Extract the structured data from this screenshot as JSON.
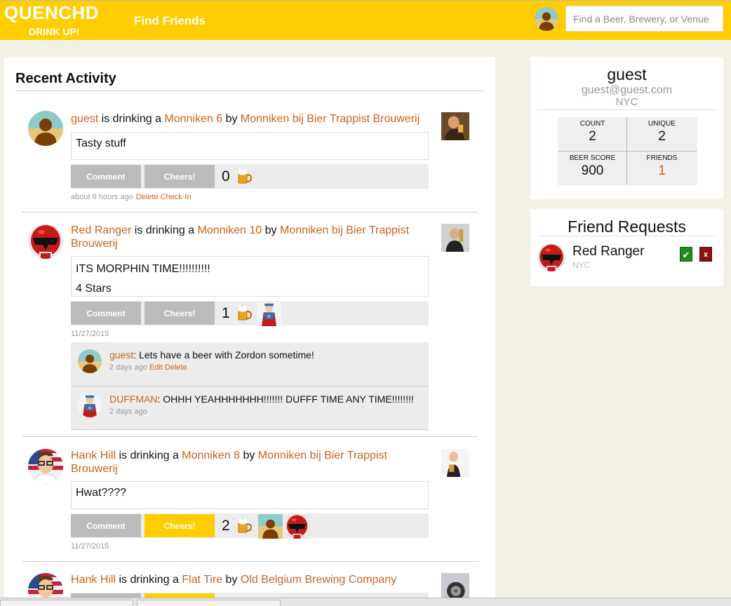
{
  "header": {
    "logo": "QUENCHD",
    "tagline": "DRINK UP!",
    "nav_find_friends": "Find Friends",
    "search_placeholder": "Find a Beer, Brewery, or Venue"
  },
  "feed": {
    "title": "Recent Activity",
    "comment_label": "Comment",
    "cheers_label": "Cheers!",
    "checkins": [
      {
        "user": "guest",
        "verb": " is drinking a ",
        "beer": "Monniken 6",
        "by": " by ",
        "brewery": "Monniken bij Bier Trappist Brouwerij",
        "text": [
          "Tasty stuff"
        ],
        "cheers_count": "0",
        "timestamp": "about 9 hours ago",
        "delete_label": "Delete Check-In"
      },
      {
        "user": "Red Ranger",
        "verb": " is drinking a ",
        "beer": "Monniken 10",
        "by": " by ",
        "brewery": "Monniken bij Bier Trappist Brouwerij",
        "text": [
          "ITS MORPHIN TIME!!!!!!!!!!",
          "4 Stars"
        ],
        "cheers_count": "1",
        "timestamp": "11/27/2015",
        "comments": [
          {
            "user": "guest",
            "text": ": Lets have a beer with Zordon sometime!",
            "time": "2 days ago",
            "edit_label": "Edit",
            "delete_label": "Delete"
          },
          {
            "user": "DUFFMAN",
            "text": ": OHHH YEAHHHHHHH!!!!!!! DUFFF TIME ANY TIME!!!!!!!!",
            "time": "2 days ago"
          }
        ]
      },
      {
        "user": "Hank Hill",
        "verb": " is drinking a ",
        "beer": "Monniken 8",
        "by": " by ",
        "brewery": "Monniken bij Bier Trappist Brouwerij",
        "text": [
          "Hwat????"
        ],
        "cheers_count": "2",
        "timestamp": "11/27/2015"
      },
      {
        "user": "Hank Hill",
        "verb": " is drinking a ",
        "beer": "Flat Tire",
        "by": " by ",
        "brewery": "Old Belgium Brewing Company"
      }
    ]
  },
  "profile": {
    "name": "guest",
    "email": "guest@guest.com",
    "location": "NYC",
    "stats": [
      {
        "label": "COUNT",
        "value": "2"
      },
      {
        "label": "UNIQUE",
        "value": "2"
      },
      {
        "label": "BEER SCORE",
        "value": "900"
      },
      {
        "label": "FRIENDS",
        "value": "1"
      }
    ]
  },
  "friend_requests": {
    "title": "Friend Requests",
    "items": [
      {
        "name": "Red Ranger",
        "location": "NYC",
        "accept_icon": "✔",
        "reject_icon": "x"
      }
    ]
  },
  "colors": {
    "brand_yellow": "#ffcd00",
    "link_orange": "#c8641e",
    "accept_green": "#1f8c1f",
    "reject_red": "#8a1212"
  }
}
